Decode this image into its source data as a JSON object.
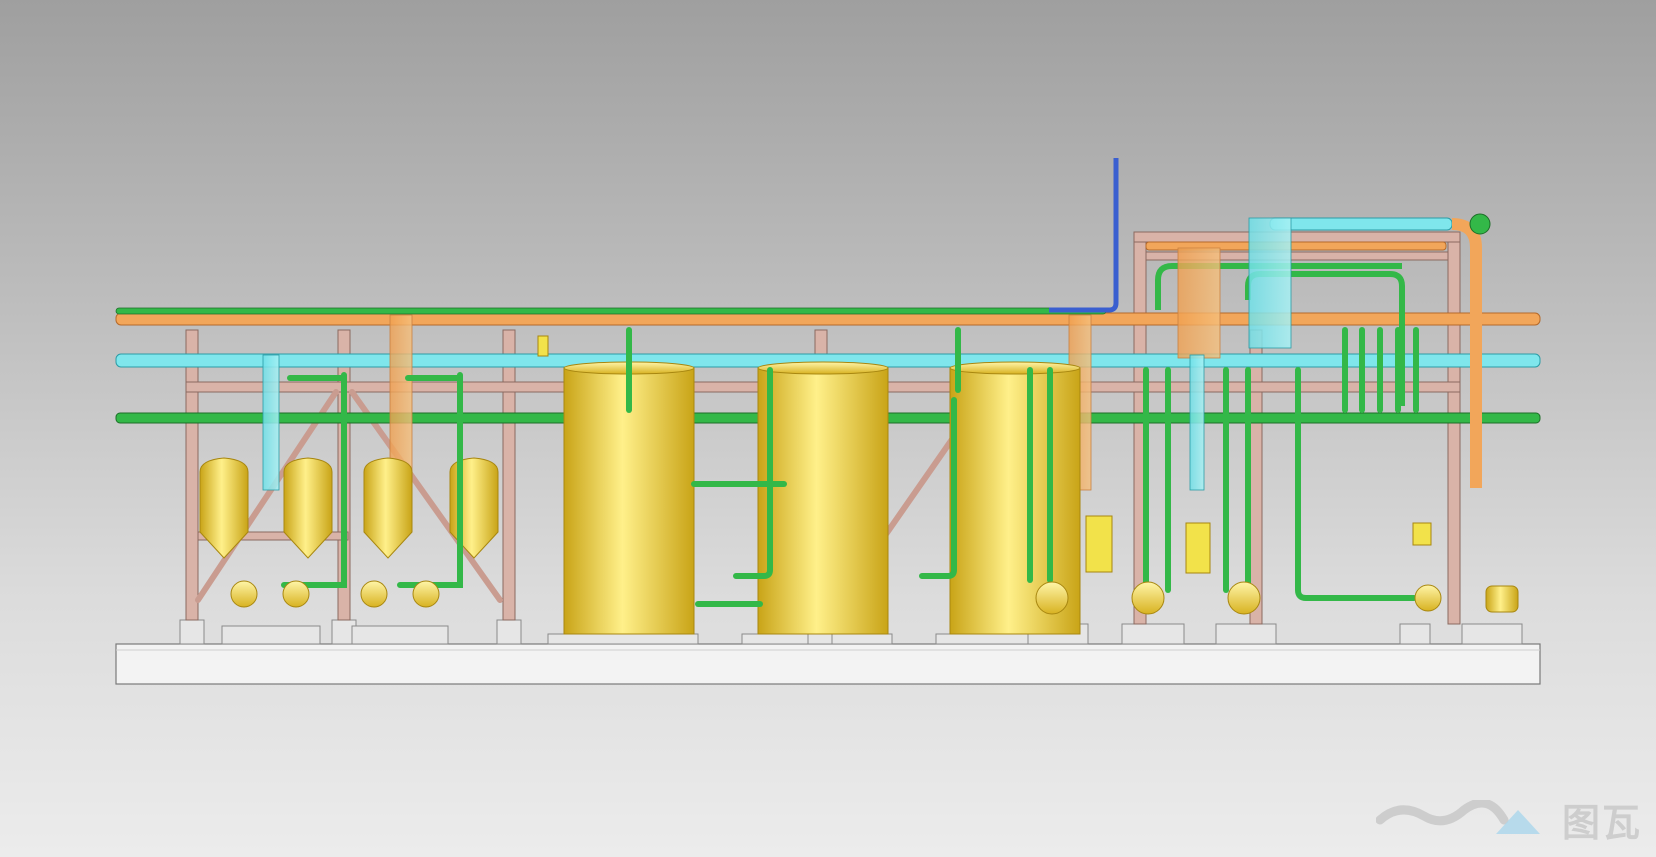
{
  "scene": {
    "description_label": "",
    "colors": {
      "background_top": "#9f9f9f",
      "background_bottom": "#ececec",
      "frame_member": "#d9b3a8",
      "frame_edge": "#8a6a60",
      "pipe_green": "#33b848",
      "pipe_green_edge": "#1d6e28",
      "pipe_orange": "#f2a65a",
      "pipe_cyan": "#7fe6ec",
      "pipe_blue": "#3a5fd0",
      "vessel_gold": "#f2d23a",
      "vessel_gold_dark": "#c9a417",
      "base_slab": "#f3f3f3",
      "base_edge": "#7a7a7a"
    },
    "components": [
      "base-slab",
      "steel-frame",
      "header-pipe-orange",
      "header-pipe-cyan",
      "header-pipe-green",
      "vent-pipe-blue",
      "large-vessel",
      "small-vessel",
      "centrifugal-pump",
      "motor",
      "control-box"
    ]
  },
  "watermark": {
    "text": "图瓦",
    "icon": "wave-logo-icon"
  }
}
